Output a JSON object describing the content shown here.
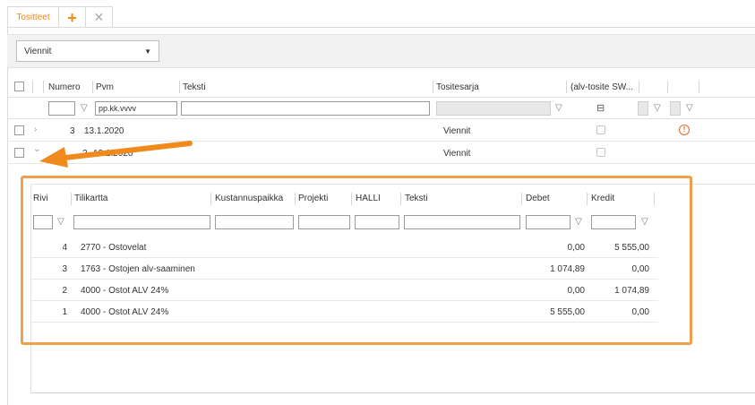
{
  "tabs": {
    "active_label": "Tositteet",
    "plus_label": "+",
    "close_label": "✕"
  },
  "toolbar": {
    "select_value": "Viennit",
    "select_caret": "▼"
  },
  "grid": {
    "headers": {
      "numero": "Numero",
      "pvm": "Pvm",
      "teksti": "Teksti",
      "tositesarja": "Tositesarja",
      "alv": "(alv-tosite SW..."
    },
    "filter": {
      "pvm_placeholder": "pp.kk.vvvv"
    },
    "rows": [
      {
        "chevron": "›",
        "numero": "3",
        "pvm": "13.1.2020",
        "tositesarja": "Viennit",
        "warning": "!"
      },
      {
        "chevron": "⌄",
        "numero": "2",
        "pvm": "13.1.2020",
        "tositesarja": "Viennit"
      }
    ]
  },
  "detail": {
    "headers": {
      "rivi": "Rivi",
      "tilikartta": "Tilikartta",
      "kustannuspaikka": "Kustannuspaikka",
      "projekti": "Projekti",
      "halli": "HALLI",
      "teksti": "Teksti",
      "debet": "Debet",
      "kredit": "Kredit"
    },
    "rows": [
      {
        "rivi": "4",
        "tilikartta": "2770 - Ostovelat",
        "debet": "0,00",
        "kredit": "5 555,00"
      },
      {
        "rivi": "3",
        "tilikartta": "1763 - Ostojen alv-saaminen",
        "debet": "1 074,89",
        "kredit": "0,00"
      },
      {
        "rivi": "2",
        "tilikartta": "4000 - Ostot ALV 24%",
        "debet": "0,00",
        "kredit": "1 074,89"
      },
      {
        "rivi": "1",
        "tilikartta": "4000 - Ostot ALV 24%",
        "debet": "5 555,00",
        "kredit": "0,00"
      }
    ]
  },
  "colors": {
    "accent": "#f08a1c",
    "highlight": "#f0a04a",
    "warning": "#e8651a"
  }
}
